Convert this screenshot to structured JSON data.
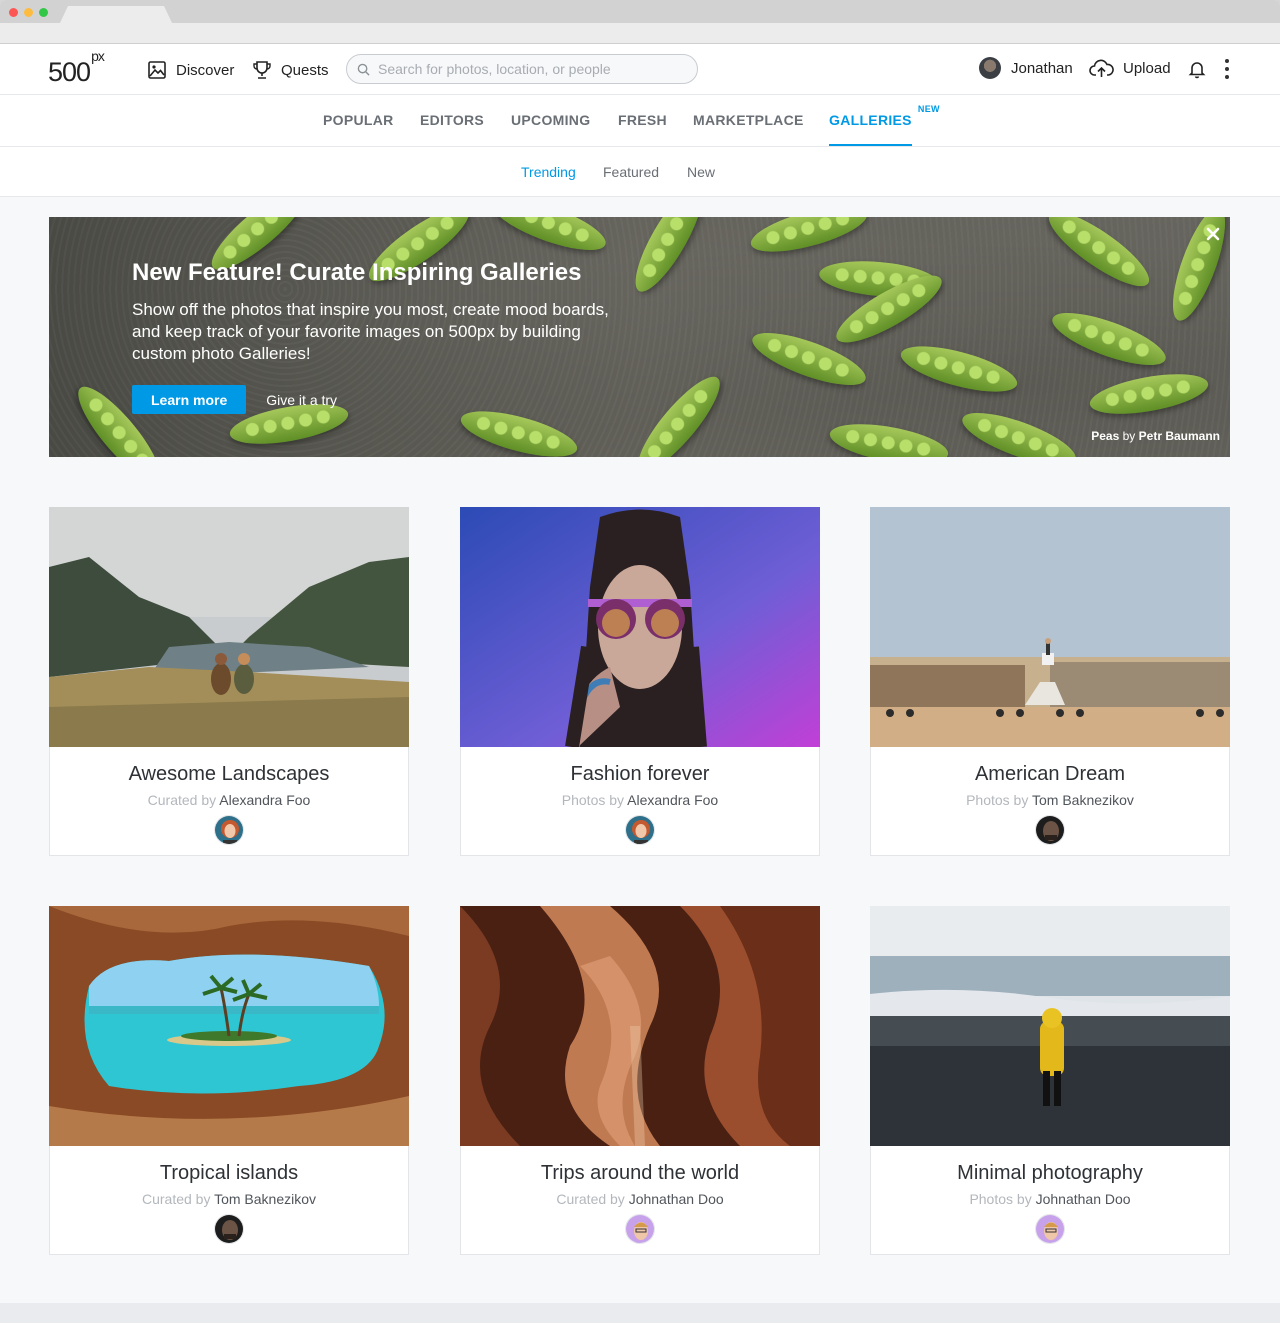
{
  "header": {
    "logo": "500",
    "logo_sup": "px",
    "discover_label": "Discover",
    "quests_label": "Quests",
    "search_placeholder": "Search for photos, location, or people",
    "user_name": "Jonathan",
    "upload_label": "Upload"
  },
  "section_tabs": [
    {
      "label": "POPULAR"
    },
    {
      "label": "EDITORS"
    },
    {
      "label": "UPCOMING"
    },
    {
      "label": "FRESH"
    },
    {
      "label": "MARKETPLACE"
    },
    {
      "label": "GALLERIES",
      "badge": "NEW",
      "active": true
    }
  ],
  "sub_tabs": [
    {
      "label": "Trending",
      "active": true
    },
    {
      "label": "Featured"
    },
    {
      "label": "New"
    }
  ],
  "banner": {
    "title": "New Feature! Curate Inspiring Galleries",
    "description": "Show off the photos that inspire you most, create mood boards, and keep track of your favorite images on 500px by building custom photo Galleries!",
    "primary_button": "Learn more",
    "secondary_link": "Give it a try",
    "credit_photo": "Peas",
    "credit_by": "by",
    "credit_author": "Petr Baumann"
  },
  "galleries": [
    {
      "title": "Awesome Landscapes",
      "by_prefix": "Curated by",
      "author": "Alexandra Foo"
    },
    {
      "title": "Fashion forever",
      "by_prefix": "Photos by",
      "author": "Alexandra Foo"
    },
    {
      "title": "American Dream",
      "by_prefix": "Photos by",
      "author": "Tom Baknezikov"
    },
    {
      "title": "Tropical islands",
      "by_prefix": "Curated by",
      "author": "Tom Baknezikov"
    },
    {
      "title": "Trips around the world",
      "by_prefix": "Curated by",
      "author": "Johnathan Doo"
    },
    {
      "title": "Minimal photography",
      "by_prefix": "Photos by",
      "author": "Johnathan Doo"
    }
  ],
  "colors": {
    "accent": "#0099e5",
    "text": "#222222",
    "muted": "#b3b7bc",
    "page_bg": "#f7f8fa"
  },
  "icons": [
    "image-icon",
    "trophy-icon",
    "search-icon",
    "upload-cloud-icon",
    "bell-icon",
    "more-vertical-icon",
    "close-icon"
  ]
}
